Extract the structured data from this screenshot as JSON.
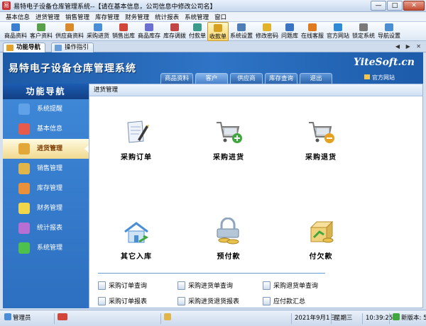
{
  "window": {
    "title": "易特电子设备仓库管理系统--【请在基本信息，公司信息中修改公司名】",
    "minimize": "—",
    "maximize": "□",
    "close": "✕"
  },
  "menu": [
    "基本信息",
    "进货管理",
    "销售管理",
    "库存管理",
    "财务管理",
    "统计报表",
    "系统管理",
    "窗口"
  ],
  "toolbar": [
    {
      "label": "商品资料",
      "icon": "product-icon",
      "color": "#3a7fd0"
    },
    {
      "label": "客户资料",
      "icon": "customer-icon",
      "color": "#5aa04a"
    },
    {
      "label": "供应商资料",
      "icon": "supplier-icon",
      "color": "#d98a2a"
    },
    {
      "label": "采购进货",
      "icon": "purchase-icon",
      "color": "#4a8fd6"
    },
    {
      "label": "销售出库",
      "icon": "sales-icon",
      "color": "#d2463a"
    },
    {
      "label": "商品库存",
      "icon": "stock-icon",
      "color": "#6a6fd0"
    },
    {
      "label": "库存调拨",
      "icon": "transfer-icon",
      "color": "#c34646"
    },
    {
      "label": "付款单",
      "icon": "payment-icon",
      "color": "#3c9b8a"
    },
    {
      "label": "收款单",
      "icon": "receipt-icon",
      "color": "#d7a01e"
    },
    {
      "label": "系统设置",
      "icon": "settings-icon",
      "color": "#4f7eb7"
    },
    {
      "label": "修改密码",
      "icon": "key-icon",
      "color": "#e0b32a"
    },
    {
      "label": "问题库",
      "icon": "question-icon",
      "color": "#3c74c4"
    },
    {
      "label": "在线客服",
      "icon": "support-icon",
      "color": "#e07a1f"
    },
    {
      "label": "官方网站",
      "icon": "web-icon",
      "color": "#2d8bd6"
    },
    {
      "label": "锁定系统",
      "icon": "lock-icon",
      "color": "#7a7a7a"
    },
    {
      "label": "导航设置",
      "icon": "nav-settings-icon",
      "color": "#4b8fd2"
    }
  ],
  "toolbar_active_index": 8,
  "tabs": [
    {
      "label": "功能导航",
      "active": true
    },
    {
      "label": "操作指引",
      "active": false
    }
  ],
  "tab_scroll": "◀ ▶ ✕",
  "banner": {
    "title": "易特电子设备仓库管理系统",
    "brand": "YiteSoft.cn",
    "site_link": "官方网站",
    "nav_tabs": [
      "商品资料",
      "客户",
      "供应商",
      "库存查询",
      "退出"
    ],
    "nav_active": 1
  },
  "sidebar": {
    "heading": "功能导航",
    "items": [
      {
        "label": "系统提醒",
        "icon": "info-icon",
        "color": "#5fa2e8"
      },
      {
        "label": "基本信息",
        "icon": "cubes-icon",
        "color": "#e65b4b"
      },
      {
        "label": "进货管理",
        "icon": "box-icon",
        "color": "#e2a93a",
        "active": true
      },
      {
        "label": "销售管理",
        "icon": "sales-box-icon",
        "color": "#e0b54a"
      },
      {
        "label": "库存管理",
        "icon": "warehouse-icon",
        "color": "#e8913a"
      },
      {
        "label": "财务管理",
        "icon": "coins-icon",
        "color": "#f2d64a"
      },
      {
        "label": "统计报表",
        "icon": "report-icon",
        "color": "#b86fd4"
      },
      {
        "label": "系统管理",
        "icon": "chart-icon",
        "color": "#4ec04e"
      }
    ]
  },
  "main": {
    "heading": "进货管理",
    "functions": [
      {
        "label": "采购订单",
        "icon": "purchase-order-icon"
      },
      {
        "label": "采购进货",
        "icon": "cart-add-icon"
      },
      {
        "label": "采购退货",
        "icon": "cart-remove-icon"
      },
      {
        "label": "其它入库",
        "icon": "house-icon"
      },
      {
        "label": "预付款",
        "icon": "prepay-icon"
      },
      {
        "label": "付欠款",
        "icon": "pay-debt-icon"
      }
    ],
    "quick_links": [
      "采购订单查询",
      "采购进货单查询",
      "采购退货单查询",
      "采购订单报表",
      "采购进货退货报表",
      "应付款汇总"
    ]
  },
  "status": {
    "user": "管理员",
    "date": "2021年9月1日",
    "weekday": "星期三",
    "time": "10:39:25",
    "version": "新版本: 5"
  }
}
